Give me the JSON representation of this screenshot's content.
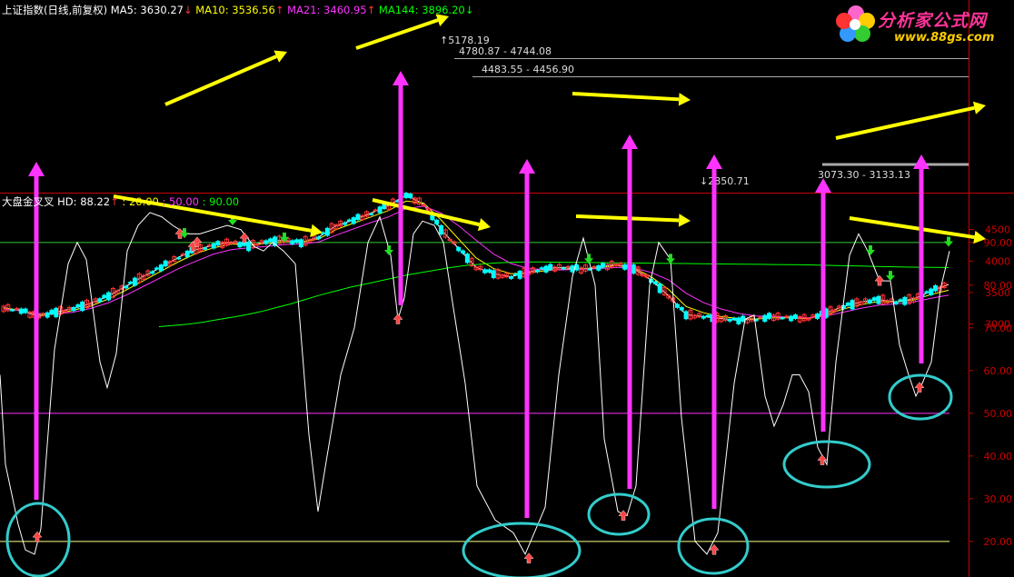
{
  "header": {
    "index_name": "上证指数(日线,前复权)",
    "ma5": "MA5: 3630.27",
    "ma10": "MA10: 3536.56",
    "ma21": "MA21: 3460.95",
    "ma144": "MA144: 3896.20"
  },
  "indicator_header": {
    "name": "大盘金叉叉",
    "hd": "HD: 88.22",
    "l20": ": 20.00",
    "l50": ": 50.00",
    "l90": ": 90.00"
  },
  "logo": {
    "text": "分析家公式网",
    "url": "www.88gs.com"
  },
  "colors": {
    "ma5": "#ffffff",
    "ma10": "#ffff00",
    "ma21": "#ff33ff",
    "ma144": "#00ff00",
    "up": "#ff3333",
    "down": "#00ffff",
    "axis": "#cc0000",
    "annot_yellow": "#ffff00",
    "annot_magenta": "#ff33ff",
    "annot_cyan": "#33cccc"
  },
  "chart_data": [
    {
      "type": "line",
      "title": "上证指数(日线,前复权)",
      "y_ticks": [
        3000,
        3500,
        4000,
        4500
      ],
      "ylim": [
        2750,
        5300
      ],
      "series": [
        {
          "name": "MA5",
          "values": [
            3260,
            3215,
            3120,
            3190,
            3250,
            3330,
            3450,
            3600,
            3760,
            3900,
            4060,
            4180,
            4250,
            4300,
            4240,
            4310,
            4330,
            4290,
            4380,
            4560,
            4650,
            4760,
            4880,
            5050,
            4900,
            4500,
            4200,
            3900,
            3800,
            3750,
            3830,
            3880,
            3900,
            3870,
            3900,
            3950,
            3880,
            3700,
            3450,
            3150,
            3120,
            3090,
            3060,
            3080,
            3120,
            3100,
            3090,
            3180,
            3280,
            3350,
            3390,
            3350,
            3400,
            3520,
            3630
          ]
        },
        {
          "name": "MA10",
          "values": [
            3250,
            3220,
            3150,
            3160,
            3220,
            3290,
            3400,
            3540,
            3690,
            3840,
            3990,
            4120,
            4210,
            4270,
            4250,
            4280,
            4310,
            4300,
            4350,
            4500,
            4600,
            4700,
            4800,
            4950,
            4920,
            4650,
            4350,
            4050,
            3880,
            3800,
            3810,
            3850,
            3870,
            3880,
            3890,
            3930,
            3890,
            3750,
            3550,
            3280,
            3180,
            3120,
            3090,
            3080,
            3100,
            3100,
            3090,
            3150,
            3240,
            3310,
            3360,
            3350,
            3380,
            3470,
            3537
          ]
        },
        {
          "name": "MA21",
          "values": [
            3240,
            3210,
            3170,
            3160,
            3190,
            3250,
            3340,
            3460,
            3600,
            3740,
            3880,
            4000,
            4110,
            4180,
            4210,
            4230,
            4260,
            4270,
            4300,
            4410,
            4510,
            4610,
            4700,
            4830,
            4870,
            4760,
            4560,
            4330,
            4110,
            3960,
            3880,
            3860,
            3860,
            3870,
            3880,
            3900,
            3890,
            3820,
            3700,
            3490,
            3340,
            3240,
            3170,
            3130,
            3120,
            3110,
            3100,
            3130,
            3190,
            3250,
            3300,
            3320,
            3350,
            3410,
            3461
          ]
        },
        {
          "name": "MA144",
          "values": [
            2960,
            2980,
            3000,
            3030,
            3070,
            3110,
            3150,
            3200,
            3260,
            3320,
            3390,
            3460,
            3520,
            3580,
            3630,
            3680,
            3730,
            3780,
            3820,
            3860,
            3900,
            3930,
            3950,
            3970,
            3980,
            3985,
            3985,
            3982,
            3980,
            3978,
            3975,
            3972,
            3970,
            3968,
            3965,
            3962,
            3960,
            3958,
            3955,
            3952,
            3950,
            3948,
            3945,
            3942,
            3940,
            3935,
            3930,
            3925,
            3920,
            3915,
            3910,
            3905,
            3902,
            3899,
            3896
          ]
        }
      ],
      "annotations": [
        "5178.19",
        "4780.87 - 4744.08",
        "4483.55 - 4456.90",
        "2850.71",
        "3073.30 - 3133.13"
      ]
    },
    {
      "type": "line",
      "title": "大盘金叉叉",
      "y_ticks": [
        20,
        30,
        40,
        50,
        60,
        70,
        80,
        90
      ],
      "ylim": [
        15.6,
        98.5
      ],
      "reference_lines": [
        20,
        50,
        90
      ],
      "series": [
        {
          "name": "HD",
          "values": [
            [
              0,
              59
            ],
            [
              6,
              38
            ],
            [
              20,
              24
            ],
            [
              28,
              18
            ],
            [
              38,
              17
            ],
            [
              45,
              23
            ],
            [
              60,
              65
            ],
            [
              75,
              85
            ],
            [
              85,
              90
            ],
            [
              95,
              86
            ],
            [
              110,
              62
            ],
            [
              118,
              56
            ],
            [
              128,
              64
            ],
            [
              140,
              88
            ],
            [
              152,
              94
            ],
            [
              165,
              97
            ],
            [
              178,
              96
            ],
            [
              190,
              94
            ],
            [
              205,
              92
            ],
            [
              220,
              92
            ],
            [
              235,
              93
            ],
            [
              250,
              94
            ],
            [
              265,
              93
            ],
            [
              280,
              89
            ],
            [
              290,
              88
            ],
            [
              300,
              90
            ],
            [
              312,
              88
            ],
            [
              325,
              85
            ],
            [
              340,
              45
            ],
            [
              350,
              27
            ],
            [
              360,
              40
            ],
            [
              375,
              59
            ],
            [
              390,
              70
            ],
            [
              405,
              90
            ],
            [
              418,
              96
            ],
            [
              430,
              87
            ],
            [
              438,
              72
            ],
            [
              445,
              77
            ],
            [
              455,
              92
            ],
            [
              465,
              95
            ],
            [
              478,
              94
            ],
            [
              488,
              90
            ],
            [
              498,
              76
            ],
            [
              512,
              57
            ],
            [
              525,
              33
            ],
            [
              545,
              25
            ],
            [
              565,
              22
            ],
            [
              578,
              17
            ],
            [
              600,
              28
            ],
            [
              615,
              59
            ],
            [
              630,
              82
            ],
            [
              642,
              91
            ],
            [
              655,
              80
            ],
            [
              665,
              44
            ],
            [
              680,
              27
            ],
            [
              690,
              26
            ],
            [
              700,
              33
            ],
            [
              715,
              80
            ],
            [
              725,
              90
            ],
            [
              738,
              86
            ],
            [
              750,
              49
            ],
            [
              765,
              20
            ],
            [
              778,
              17
            ],
            [
              790,
              22
            ],
            [
              808,
              57
            ],
            [
              820,
              72
            ],
            [
              830,
              73
            ],
            [
              842,
              54
            ],
            [
              852,
              47
            ],
            [
              862,
              52
            ],
            [
              872,
              59
            ],
            [
              880,
              59
            ],
            [
              890,
              55
            ],
            [
              900,
              42
            ],
            [
              910,
              38
            ],
            [
              920,
              62
            ],
            [
              935,
              87
            ],
            [
              945,
              92
            ],
            [
              955,
              88
            ],
            [
              968,
              81
            ],
            [
              980,
              81
            ],
            [
              990,
              66
            ],
            [
              1000,
              59
            ],
            [
              1008,
              54
            ],
            [
              1015,
              57
            ],
            [
              1025,
              62
            ],
            [
              1035,
              79
            ],
            [
              1045,
              88
            ]
          ]
        }
      ],
      "signals": {
        "buy_up_arrows": [
          [
            41,
            21
          ],
          [
            198,
            92
          ],
          [
            212,
            89
          ],
          [
            217,
            90
          ],
          [
            269,
            91
          ],
          [
            438,
            72
          ],
          [
            582,
            16
          ],
          [
            686,
            26
          ],
          [
            786,
            18
          ],
          [
            905,
            39
          ],
          [
            968,
            81
          ],
          [
            1012,
            56
          ]
        ],
        "sell_down_arrows": [
          [
            203,
            91
          ],
          [
            256,
            94
          ],
          [
            313,
            90
          ],
          [
            428,
            87
          ],
          [
            648,
            85
          ],
          [
            738,
            85
          ],
          [
            958,
            87
          ],
          [
            980,
            81
          ],
          [
            1044,
            89
          ]
        ]
      }
    }
  ]
}
